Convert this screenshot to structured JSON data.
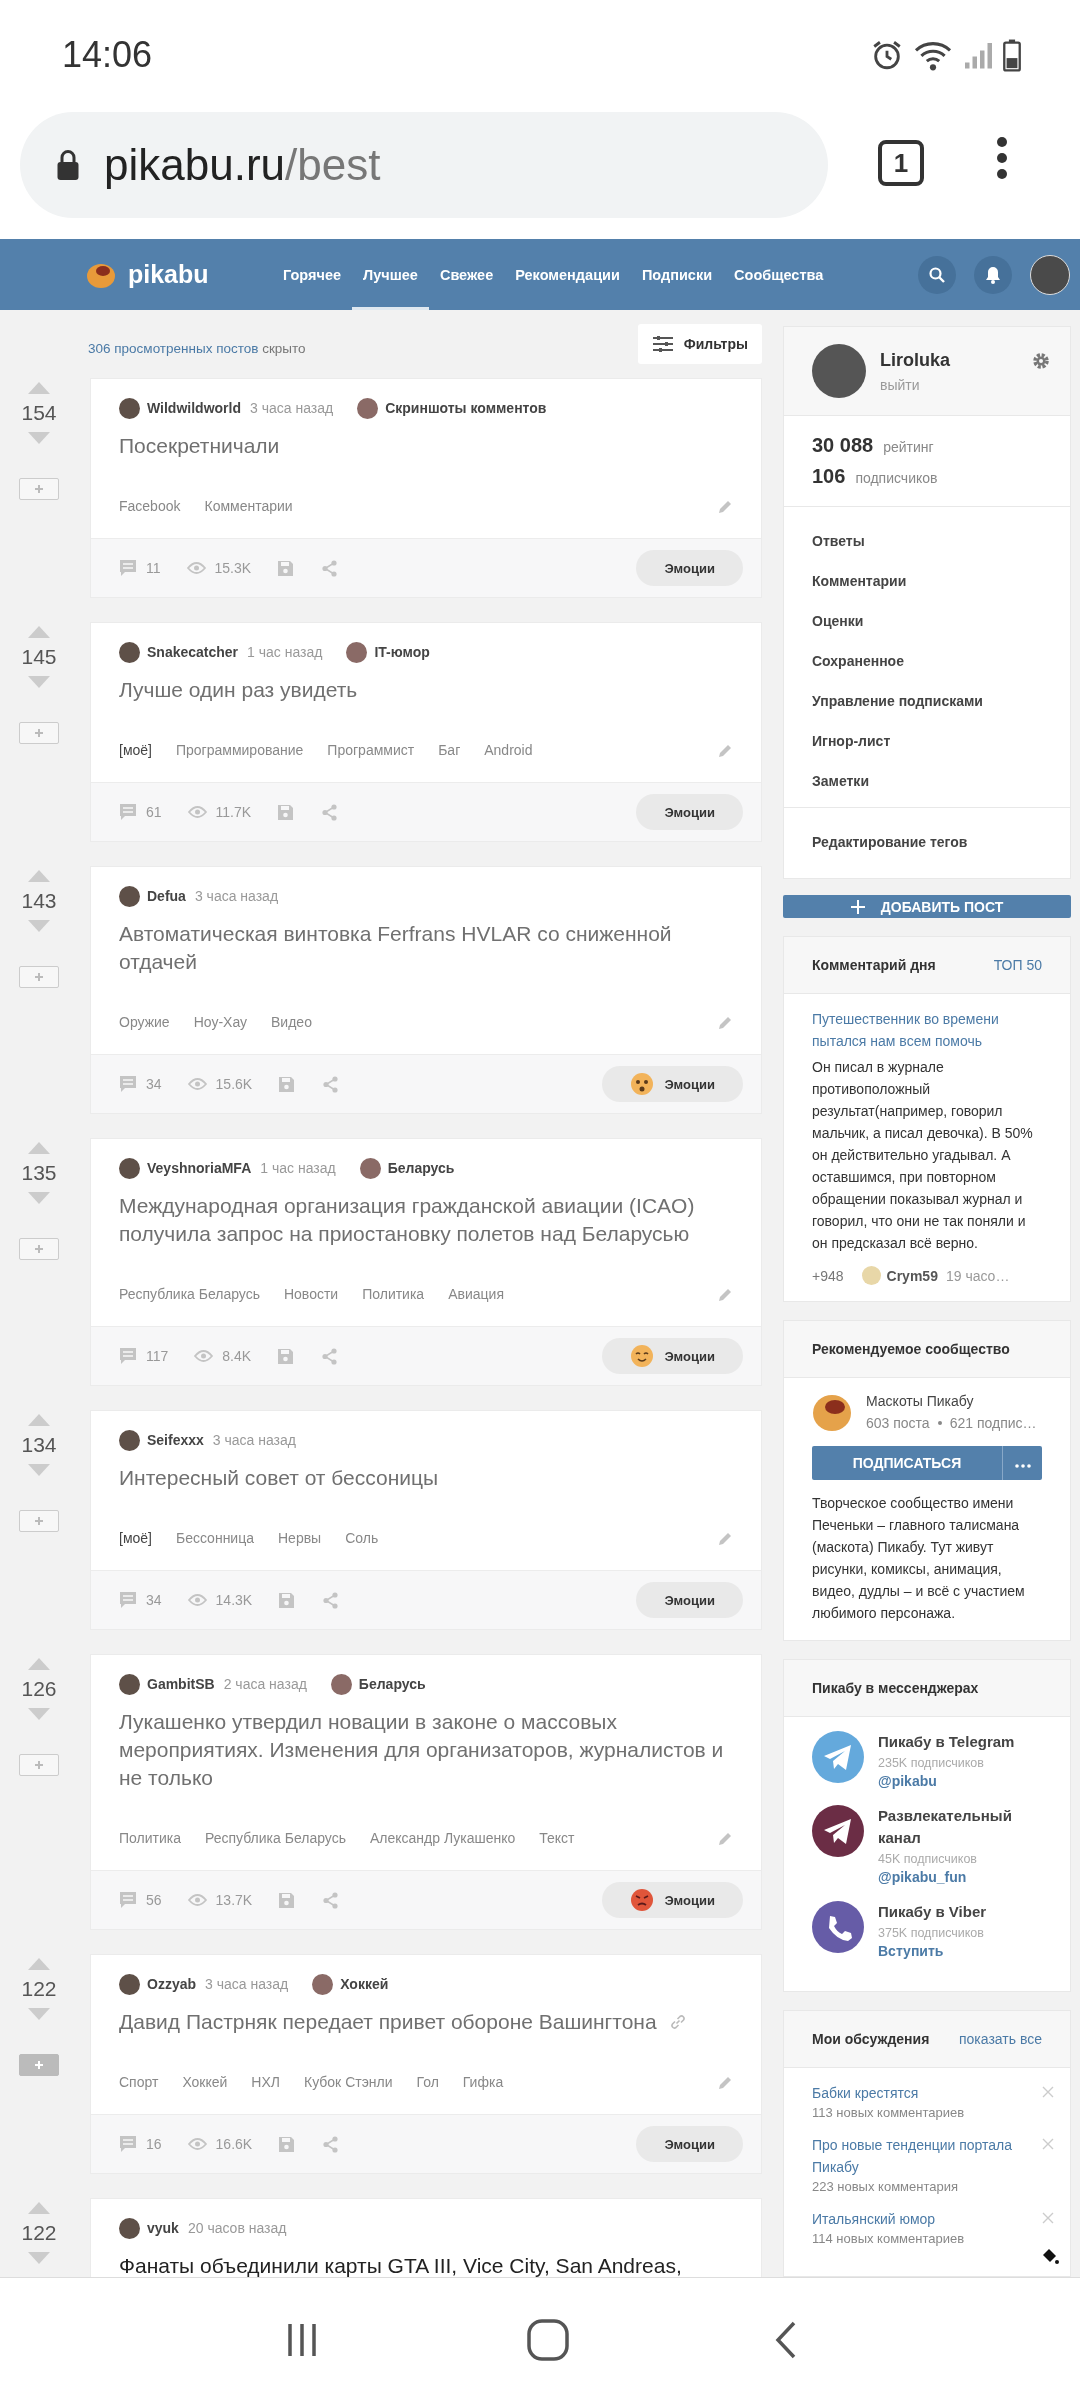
{
  "status_bar": {
    "time": "14:06"
  },
  "browser": {
    "domain": "pikabu.ru",
    "path": "/best",
    "tab_count": "1"
  },
  "header": {
    "logo": "pikabu",
    "nav": [
      {
        "label": "Горячее",
        "selected": false
      },
      {
        "label": "Лучшее",
        "selected": true
      },
      {
        "label": "Свежее",
        "selected": false
      },
      {
        "label": "Рекомендации",
        "selected": false
      },
      {
        "label": "Подписки",
        "selected": false
      },
      {
        "label": "Сообщества",
        "selected": false
      }
    ]
  },
  "feed": {
    "hidden_link": "306 просмотренных постов",
    "hidden_text": "скрыто",
    "filters_button": "Фильтры",
    "posts": [
      {
        "votes": "154",
        "added": false,
        "author": "Wildwildworld",
        "time": "3 часа назад",
        "community": "Скриншоты комментов",
        "title": "Посекретничали",
        "visited": true,
        "link": false,
        "tags": [
          {
            "label": "Facebook",
            "kind": "tag"
          },
          {
            "label": "Комментарии",
            "kind": "tag"
          }
        ],
        "comments": "11",
        "views": "15.3K",
        "emotions": {
          "label": "Эмоции",
          "kind": "plain"
        }
      },
      {
        "votes": "145",
        "added": false,
        "author": "Snakecatcher",
        "time": "1 час назад",
        "community": "IT-юмор",
        "title": "Лучше один раз увидеть",
        "visited": true,
        "link": false,
        "tags": [
          {
            "label": "[моё]",
            "kind": "mine"
          },
          {
            "label": "Программирование",
            "kind": "tag"
          },
          {
            "label": "Программист",
            "kind": "tag"
          },
          {
            "label": "Баг",
            "kind": "tag"
          },
          {
            "label": "Android",
            "kind": "tag"
          }
        ],
        "comments": "61",
        "views": "11.7K",
        "emotions": {
          "label": "Эмоции",
          "kind": "plain"
        }
      },
      {
        "votes": "143",
        "added": false,
        "author": "Defua",
        "time": "3 часа назад",
        "title": "Автоматическая винтовка Ferfrans HVLAR со сниженной отдачей",
        "visited": true,
        "link": false,
        "tags": [
          {
            "label": "Оружие",
            "kind": "tag"
          },
          {
            "label": "Ноу-Хау",
            "kind": "tag"
          },
          {
            "label": "Видео",
            "kind": "tag"
          }
        ],
        "comments": "34",
        "views": "15.6K",
        "emotions": {
          "label": "Эмоции",
          "kind": "surprised"
        }
      },
      {
        "votes": "135",
        "added": false,
        "author": "VeyshnoriaMFA",
        "time": "1 час назад",
        "community": "Беларусь",
        "title": "Международная организация гражданской авиации (ICAO) получила запрос на приостановку полетов над Беларусью",
        "visited": true,
        "link": false,
        "tags": [
          {
            "label": "Республика Беларусь",
            "kind": "tag"
          },
          {
            "label": "Новости",
            "kind": "tag"
          },
          {
            "label": "Политика",
            "kind": "tag"
          },
          {
            "label": "Авиация",
            "kind": "tag"
          }
        ],
        "comments": "117",
        "views": "8.4K",
        "emotions": {
          "label": "Эмоции",
          "kind": "smiling"
        }
      },
      {
        "votes": "134",
        "added": false,
        "author": "Seifexxx",
        "time": "3 часа назад",
        "title": "Интересный совет от бессоницы",
        "visited": true,
        "link": false,
        "tags": [
          {
            "label": "[моё]",
            "kind": "mine"
          },
          {
            "label": "Бессонница",
            "kind": "tag"
          },
          {
            "label": "Нервы",
            "kind": "tag"
          },
          {
            "label": "Соль",
            "kind": "tag"
          }
        ],
        "comments": "34",
        "views": "14.3K",
        "emotions": {
          "label": "Эмоции",
          "kind": "plain"
        }
      },
      {
        "votes": "126",
        "added": false,
        "author": "GambitSB",
        "time": "2 часа назад",
        "community": "Беларусь",
        "title": "Лукашенко утвердил новации в законе о массовых мероприятиях. Изменения для организаторов, журналистов и не только",
        "visited": true,
        "link": false,
        "tags": [
          {
            "label": "Политика",
            "kind": "tag"
          },
          {
            "label": "Республика Беларусь",
            "kind": "tag"
          },
          {
            "label": "Александр Лукашенко",
            "kind": "tag"
          },
          {
            "label": "Текст",
            "kind": "tag"
          }
        ],
        "comments": "56",
        "views": "13.7K",
        "emotions": {
          "label": "Эмоции",
          "kind": "angry"
        }
      },
      {
        "votes": "122",
        "added": true,
        "author": "Ozzyab",
        "time": "3 часа назад",
        "community": "Хоккей",
        "title": "Давид Пастрняк передает привет обороне Вашингтона",
        "visited": true,
        "link": true,
        "tags": [
          {
            "label": "Спорт",
            "kind": "tag"
          },
          {
            "label": "Хоккей",
            "kind": "tag"
          },
          {
            "label": "НХЛ",
            "kind": "tag"
          },
          {
            "label": "Кубок Стэнли",
            "kind": "tag"
          },
          {
            "label": "Гол",
            "kind": "tag"
          },
          {
            "label": "Гифка",
            "kind": "tag"
          }
        ],
        "comments": "16",
        "views": "16.6K",
        "emotions": {
          "label": "Эмоции",
          "kind": "plain"
        }
      },
      {
        "votes": "122",
        "author": "vyuk",
        "time": "20 часов назад",
        "title": "Фанаты объединили карты GTA III, Vice City, San Andreas,",
        "visited": false
      }
    ]
  },
  "sidebar": {
    "profile": {
      "name": "Liroluka",
      "logout": "выйти",
      "rating": "30 088",
      "rating_label": "рейтинг",
      "subscribers": "106",
      "subscribers_label": "подписчиков",
      "menu": [
        "Ответы",
        "Комментарии",
        "Оценки",
        "Сохраненное",
        "Управление подписками",
        "Игнор-лист",
        "Заметки"
      ],
      "menu_extra": [
        "Редактирование тегов"
      ]
    },
    "add_post_button": "ДОБАВИТЬ ПОСТ",
    "comment_of_day": {
      "title": "Комментарий дня",
      "top_link": "ТОП 50",
      "post_link": "Путешественник во времени пытался нам всем помочь",
      "text": "Он писал в журнале противоположный результат(например, говорил мальчик, а писал девочка). В 50% он действительно угадывал. А оставшимся, при повторном обращении показывал журнал и говорил, что они не так поняли и он предсказал всё верно.",
      "score": "+948",
      "author": "Crym59",
      "time": "19 часо…"
    },
    "recommended": {
      "title": "Рекомендуемое сообщество",
      "name": "Маскоты Пикабу",
      "posts": "603 поста",
      "subscribers": "621 подпис…",
      "subscribe_button": "ПОДПИСАТЬСЯ",
      "description": "Творческое сообщество имени Печеньки – главного талисмана (маскота) Пикабу. Тут живут рисунки, комиксы, анимация, видео, дудлы – и всё с участием любимого персонажа."
    },
    "messengers": {
      "title": "Пикабу в мессенджерах",
      "items": [
        {
          "kind": "plane",
          "color": "#64a9dc",
          "name": "Пикабу в Telegram",
          "subscribers": "235K подписчиков",
          "link": "@pikabu"
        },
        {
          "kind": "plane",
          "color": "#6b2d45",
          "name": "Развлекательный канал",
          "subscribers": "45K подписчиков",
          "link": "@pikabu_fun"
        },
        {
          "kind": "phone",
          "color": "#665ca7",
          "name": "Пикабу в Viber",
          "subscribers": "375K подписчиков",
          "link": "Вступить"
        }
      ]
    },
    "discussions": {
      "title": "Мои обсуждения",
      "show_all": "показать все",
      "items": [
        {
          "title": "Бабки крестятся",
          "count": "113 новых комментариев"
        },
        {
          "title": "Про новые тенденции портала Пикабу",
          "count": "223 новых комментария"
        },
        {
          "title": "Итальянский юмор",
          "count": "114 новых комментариев"
        }
      ]
    }
  }
}
